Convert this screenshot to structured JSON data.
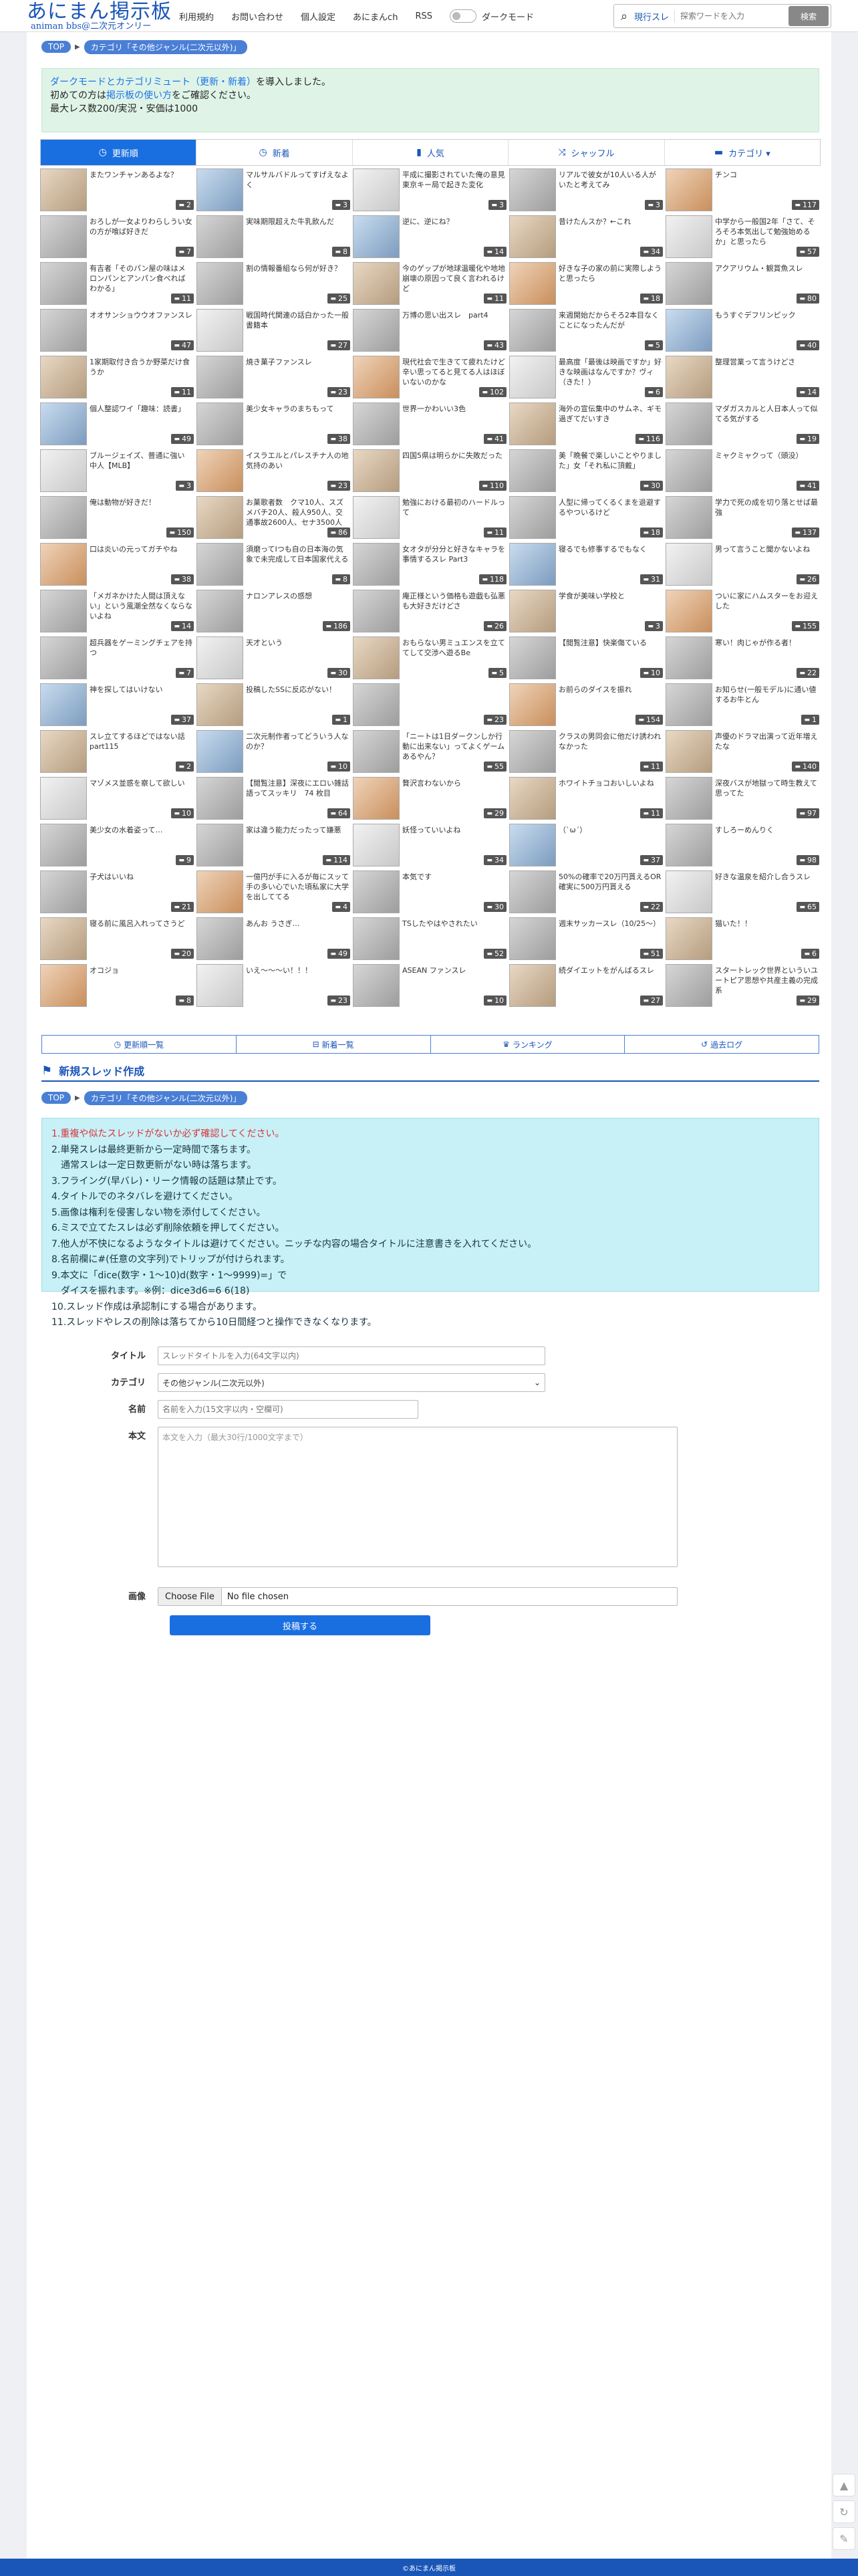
{
  "header": {
    "logo_main": "あにまん掲示板",
    "logo_sub": "animan bbs@二次元オンリー",
    "nav": [
      "利用規約",
      "お問い合わせ",
      "個人設定",
      "あにまんch",
      "RSS"
    ],
    "dark_mode_label": "ダークモード",
    "search_scope": "現行スレ",
    "search_placeholder": "探索ワードを入力",
    "search_button": "検索"
  },
  "breadcrumb": {
    "top": "TOP",
    "category": "カテゴリ「その他ジャンル(二次元以外)」"
  },
  "notice": {
    "line1_a": "ダークモードとカテゴリミュート（更新・新着）",
    "line1_b": "を導入しました。",
    "line2_a": "初めての方は",
    "line2_link": "掲示板の使い方",
    "line2_b": "をご確認ください。",
    "line3": "最大レス数200/実況・安価は1000"
  },
  "tabs": [
    {
      "label": "更新順",
      "icon": "clock-icon",
      "glyph": "◷"
    },
    {
      "label": "新着",
      "icon": "time-icon",
      "glyph": "◷"
    },
    {
      "label": "人気",
      "icon": "bar-chart-icon",
      "glyph": "▮"
    },
    {
      "label": "シャッフル",
      "icon": "shuffle-icon",
      "glyph": "⤨"
    },
    {
      "label": "カテゴリ ▾",
      "icon": "folder-icon",
      "glyph": "▬"
    }
  ],
  "threads": [
    {
      "t": "またワンチャンあるよな？",
      "n": "2"
    },
    {
      "t": "マルサルバドルってすげえなよく",
      "n": "3"
    },
    {
      "t": "平成に撮影されていた俺の意見東京キー局で起きた変化",
      "n": "3"
    },
    {
      "t": "リアルで彼女が10人いる人がいたと考えてみ",
      "n": "3"
    },
    {
      "t": "チンコ",
      "n": "117"
    },
    {
      "t": "おろしが一女よりわらしうい女の方が喰ば好きだ",
      "n": "7"
    },
    {
      "t": "実味期限超えた牛乳飲んだ",
      "n": "8"
    },
    {
      "t": "逆に、逆にね？",
      "n": "14"
    },
    {
      "t": "昔けたんスか？←これ",
      "n": "34"
    },
    {
      "t": "中学から一般国2年「さて、そろそろ本気出して勉強始めるか」と思ったら",
      "n": "57"
    },
    {
      "t": "有吉者「そのパン屋の味はメロンパンとアンパン食べればわかる」",
      "n": "11"
    },
    {
      "t": "割の情報番組なら何が好き？",
      "n": "25"
    },
    {
      "t": "今のゲップが地球温暖化や地地崩壊の原因って良く言われるけど",
      "n": "11"
    },
    {
      "t": "好きな子の家の前に実際しようと思ったら",
      "n": "18"
    },
    {
      "t": "アクアリウム・観賞魚スレ",
      "n": "80"
    },
    {
      "t": "オオサンショウウオファンスレ",
      "n": "47"
    },
    {
      "t": "戦国時代関連の話白かった一般書籍本",
      "n": "27"
    },
    {
      "t": "万博の思い出スレ　part4",
      "n": "43"
    },
    {
      "t": "来週開始だからそろ2本目なくことになったんだが",
      "n": "5"
    },
    {
      "t": "もうすぐデフリンピック",
      "n": "40"
    },
    {
      "t": "1家期取付き合うか野菜だけ食うか",
      "n": "11"
    },
    {
      "t": "焼き菓子ファンスレ",
      "n": "23"
    },
    {
      "t": "現代社会で生きてて疲れたけど辛い思ってると見てる人はほぼいないのかな",
      "n": "102"
    },
    {
      "t": "最高度「最後は映画ですか」好きな映画はなんですか？ヴィ（きた！）",
      "n": "6"
    },
    {
      "t": "整理営業って言うけどさ",
      "n": "14"
    },
    {
      "t": "個人整認ワイ「趣味：読書」",
      "n": "49"
    },
    {
      "t": "美少女キャラのまちもって",
      "n": "38"
    },
    {
      "t": "世界一かわいい3色",
      "n": "41"
    },
    {
      "t": "海外の宣伝集中のサムネ、ギモ過ぎてだいすき",
      "n": "116"
    },
    {
      "t": "マダガスカルと人日本人って似てる気がする",
      "n": "19"
    },
    {
      "t": "ブルージェイズ、普通に強い 中人【MLB】",
      "n": "3"
    },
    {
      "t": "イスラエルとパレスチナ人の地気持のあい",
      "n": "23"
    },
    {
      "t": "四国5県は明らかに失敗だった",
      "n": "110"
    },
    {
      "t": "美「晩餐で楽しいことやりました」女「それ私に頂戴」",
      "n": "30"
    },
    {
      "t": "ミャクミャクって（頭没）",
      "n": "41"
    },
    {
      "t": "俺は動物が好きだ！",
      "n": "150"
    },
    {
      "t": "お菓歌者数　クマ10人、スズメバチ20人、殺人950人、交通事故2600人、セナ3500人",
      "n": "86"
    },
    {
      "t": "勉強における最初のハードルって",
      "n": "11"
    },
    {
      "t": "人型に帰ってくるくまを退避するやついるけど",
      "n": "18"
    },
    {
      "t": "学力で死の成を切り落とせば最強",
      "n": "137"
    },
    {
      "t": "口は炎いの元ってガチやね",
      "n": "38"
    },
    {
      "t": "須磨ってIつも自の日本海の気象で未完成して日本国家代える",
      "n": "8"
    },
    {
      "t": "女オタが分分と好きなキャラを事情するスレ Part3",
      "n": "118"
    },
    {
      "t": "寝るでも修事するでもなく",
      "n": "31"
    },
    {
      "t": "男って言うこと聞かないよね",
      "n": "26"
    },
    {
      "t": "「メガネかけた人間は頂えない」という風潮全然なくならないよね",
      "n": "14"
    },
    {
      "t": "ナロンアレスの感想",
      "n": "186"
    },
    {
      "t": "庵正様という価格も遊戯も弘悪も大好きだけどさ",
      "n": "26"
    },
    {
      "t": "学食が美味い学校と",
      "n": "3"
    },
    {
      "t": "ついに家にハムスターをお迎えした",
      "n": "155"
    },
    {
      "t": "超兵器をゲーミングチェアを持つ",
      "n": "7"
    },
    {
      "t": "天才という",
      "n": "30"
    },
    {
      "t": "おもらない男ミュエンスを立ててして交渉へ遊るBe",
      "n": "5"
    },
    {
      "t": "【閲覧注意】快楽傷ている",
      "n": "10"
    },
    {
      "t": "寒い！肉じゃが作る者！",
      "n": "22"
    },
    {
      "t": "神を探してはいけない",
      "n": "37"
    },
    {
      "t": "投稿したSSに反応がない！",
      "n": "1"
    },
    {
      "t": "",
      "n": "23"
    },
    {
      "t": "お前らのダイスを振れ",
      "n": "154"
    },
    {
      "t": "お知らせ(一般モデル)に通い値するお牛とん",
      "n": "1"
    },
    {
      "t": "スレ立てするほどではない話part115",
      "n": "2"
    },
    {
      "t": "二次元制作者ってどういう人なのか？",
      "n": "10"
    },
    {
      "t": "「ニートは1日ダークンしか行動に出来ない」ってよくゲームあるやん？",
      "n": "55"
    },
    {
      "t": "クラスの男同会に他だけ誘われなかった",
      "n": "11"
    },
    {
      "t": "声優のドラマ出演って近年増えたな",
      "n": "140"
    },
    {
      "t": "マゾメス並惑を察して欲しい",
      "n": "10"
    },
    {
      "t": "【閲覧注意】深夜にエロい雑話語ってスッキリ　74 枚目",
      "n": "64"
    },
    {
      "t": "贅沢言わないから",
      "n": "29"
    },
    {
      "t": "ホワイトチョコおいしいよね",
      "n": "11"
    },
    {
      "t": "深夜バスが地獄って時生教えて思ってた",
      "n": "97"
    },
    {
      "t": "美少女の水着姿って…",
      "n": "9"
    },
    {
      "t": "家は違う能力だったって嫌悪",
      "n": "114"
    },
    {
      "t": "妖怪っていいよね",
      "n": "34"
    },
    {
      "t": "（`ω´）",
      "n": "37"
    },
    {
      "t": "すしろーめんりく",
      "n": "98"
    },
    {
      "t": "子犬はいいね",
      "n": "21"
    },
    {
      "t": "一億円が手に入るが毎にスッて手の多い心でいた頃私家に大学を出しててる",
      "n": "4"
    },
    {
      "t": "本気です",
      "n": "30"
    },
    {
      "t": "50%の確率で20万円貰えるOR確実に500万円貰える",
      "n": "22"
    },
    {
      "t": "好きな温泉を紹介し合うスレ",
      "n": "65"
    },
    {
      "t": "寝る前に風呂入れってさうど",
      "n": "20"
    },
    {
      "t": "あんお うさぎ…",
      "n": "49"
    },
    {
      "t": "TSしたやはやされたい",
      "n": "52"
    },
    {
      "t": "週末サッカースレ（10/25～）",
      "n": "51"
    },
    {
      "t": "猫いた！！",
      "n": "6"
    },
    {
      "t": "オコジョ",
      "n": "8"
    },
    {
      "t": "いえ〜〜〜い！！！",
      "n": "23"
    },
    {
      "t": "ASEAN ファンスレ",
      "n": "10"
    },
    {
      "t": "続ダイエットをがんばるスレ",
      "n": "27"
    },
    {
      "t": "スタートレック世界といういユートピア思想や共産主義の完成系",
      "n": "29"
    }
  ],
  "subnav": [
    {
      "label": "更新順一覧",
      "icon": "clock-icon"
    },
    {
      "label": "新着一覧",
      "icon": "new-icon"
    },
    {
      "label": "ランキング",
      "icon": "crown-icon"
    },
    {
      "label": "過去ログ",
      "icon": "history-icon"
    }
  ],
  "new_thread": {
    "heading": "新規スレッド作成",
    "rules": [
      "1.重複や似たスレッドがないか必ず確認してください。",
      "2.単発スレは最終更新から一定時間で落ちます。",
      "　通常スレは一定日数更新がない時は落ちます。",
      "3.フライング(早バレ)・リーク情報の話題は禁止です。",
      "4.タイトルでのネタバレを避けてください。",
      "5.画像は権利を侵害しない物を添付してください。",
      "6.ミスで立てたスレは必ず削除依頼を押してください。",
      "7.他人が不快になるようなタイトルは避けてください。ニッチな内容の場合タイトルに注意書きを入れてください。",
      "8.名前欄に#(任意の文字列)でトリップが付けられます。",
      "9.本文に「dice(数字・1〜10)d(数字・1〜9999)=」で",
      "　ダイスを振れます。※例：dice3d6=6 6(18)",
      "10.スレッド作成は承認制にする場合があります。",
      "11.スレッドやレスの削除は落ちてから10日間経つと操作できなくなります。"
    ],
    "title_label": "タイトル",
    "title_placeholder": "スレッドタイトルを入力(64文字以内)",
    "category_label": "カテゴリ",
    "category_value": "その他ジャンル(二次元以外)",
    "name_label": "名前",
    "name_placeholder": "名前を入力(15文字以内・空欄可)",
    "body_label": "本文",
    "body_placeholder": "本文を入力（最大30行/1000文字まで）",
    "image_label": "画像",
    "file_button": "Choose File",
    "file_status": "No file chosen",
    "submit": "投稿する"
  },
  "footer": "©あにまん掲示板"
}
